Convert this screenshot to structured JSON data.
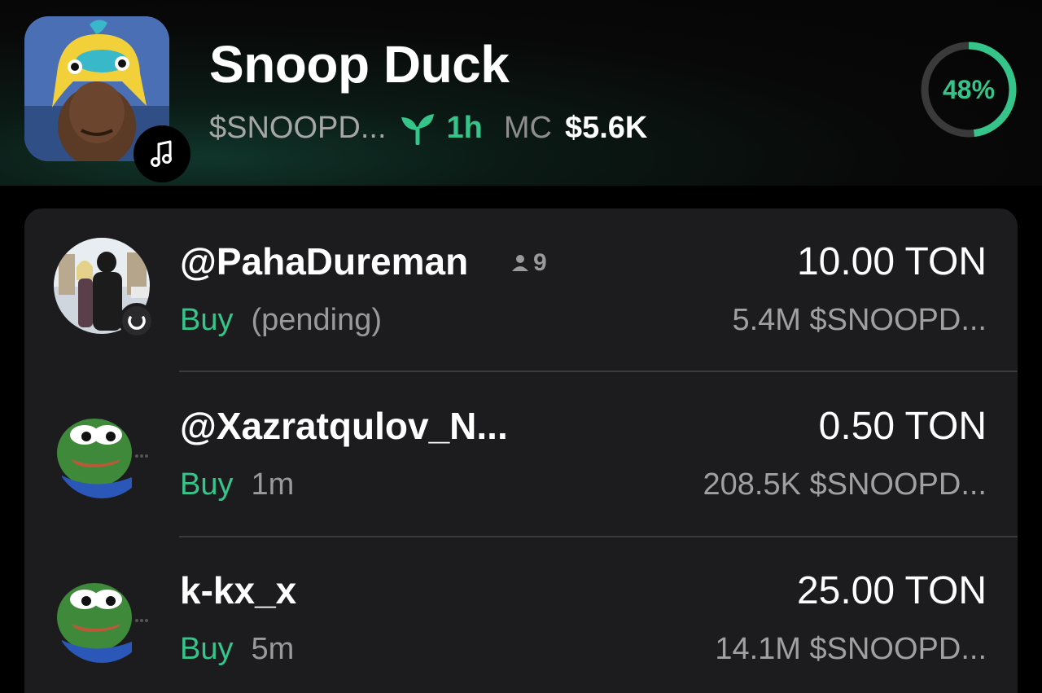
{
  "token": {
    "name": "Snoop Duck",
    "ticker": "$SNOOPD...",
    "age": "1h",
    "mc_label": "MC",
    "mc_value": "$5.6K",
    "progress_label": "48%",
    "progress_fraction": 0.48,
    "avatar_icon": "snoop-duck-avatar",
    "badge_icon": "music-note-icon"
  },
  "colors": {
    "accent_green": "#35c48a",
    "card_bg": "#1c1c1e",
    "muted_text": "#a0a0a0"
  },
  "trades": [
    {
      "name": "@PahaDureman",
      "holders": "9",
      "action": "Buy",
      "status": "(pending)",
      "amount": "10.00 TON",
      "tokens": "5.4M $SNOOPD..."
    },
    {
      "name": "@Xazratqulov_N...",
      "action": "Buy",
      "status": "1m",
      "amount": "0.50 TON",
      "tokens": "208.5K $SNOOPD..."
    },
    {
      "name": "k-kx_x",
      "action": "Buy",
      "status": "5m",
      "amount": "25.00 TON",
      "tokens": "14.1M $SNOOPD..."
    }
  ]
}
